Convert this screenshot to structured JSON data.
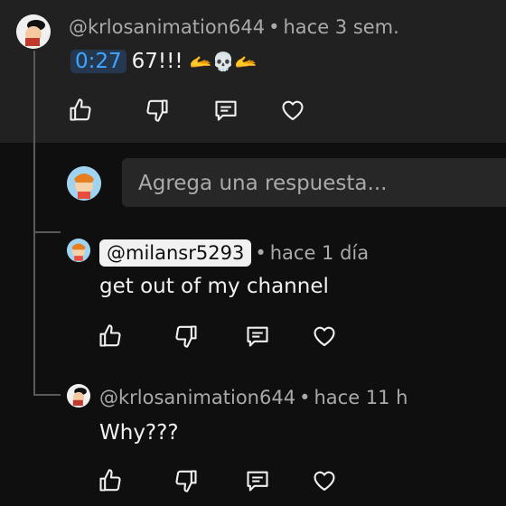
{
  "comment": {
    "handle": "@krlosanimation644",
    "time": "hace 3 sem.",
    "timestamp_link": "0:27",
    "text": "67!!!",
    "emojis": [
      "🫴",
      "💀",
      "🫴"
    ]
  },
  "reply_input": {
    "placeholder": "Agrega una respuesta..."
  },
  "replies": [
    {
      "handle": "@milansr5293",
      "time": "hace 1 día",
      "text": "get out of my channel",
      "highlighted": true
    },
    {
      "handle": "@krlosanimation644",
      "time": "hace 11 h",
      "text": "Why???",
      "highlighted": false
    }
  ],
  "separator": "•",
  "actions": [
    "like-icon",
    "dislike-icon",
    "reply-icon",
    "heart-icon"
  ],
  "colors": {
    "background": "#0f0f0f",
    "top_panel": "#212121",
    "timestamp_link": "#3ea6ff",
    "secondary_text": "#aaaaaa"
  }
}
